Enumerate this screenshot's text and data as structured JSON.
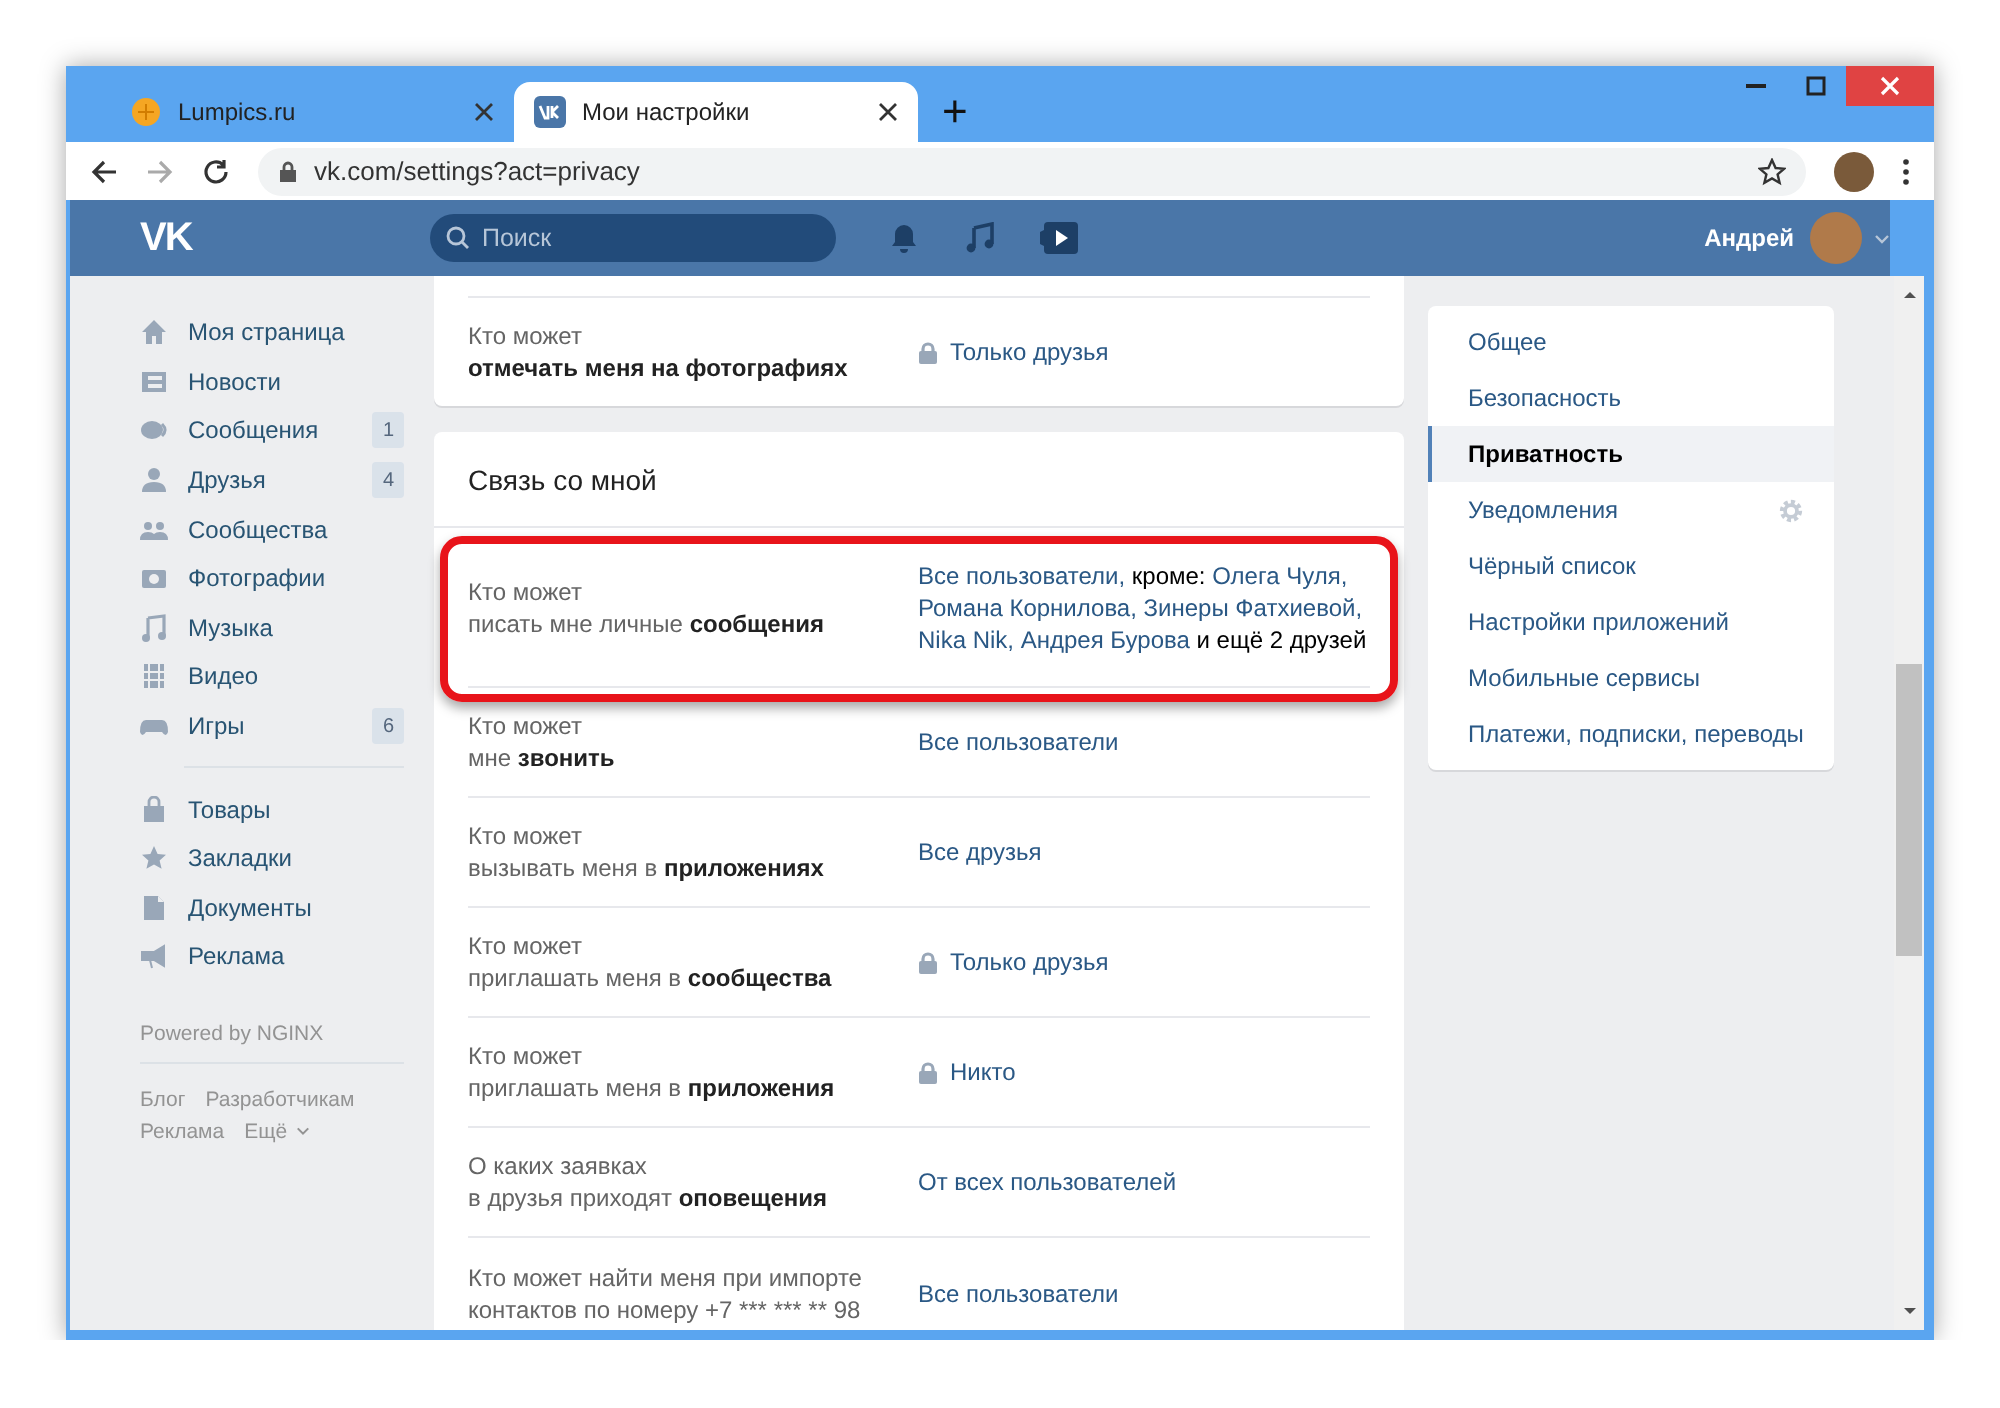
{
  "browser": {
    "tabs": [
      {
        "title": "Lumpics.ru",
        "selected": false
      },
      {
        "title": "Мои настройки",
        "selected": true
      }
    ],
    "new_tab": "+",
    "url": "vk.com/settings?act=privacy"
  },
  "header": {
    "logo": "VK",
    "search_placeholder": "Поиск",
    "user_name": "Андрей"
  },
  "sidebar": {
    "groups": [
      [
        {
          "label": "Моя страница"
        },
        {
          "label": "Новости"
        },
        {
          "label": "Сообщения",
          "counter": "1"
        },
        {
          "label": "Друзья",
          "counter": "4"
        },
        {
          "label": "Сообщества"
        },
        {
          "label": "Фотографии"
        },
        {
          "label": "Музыка"
        },
        {
          "label": "Видео"
        },
        {
          "label": "Игры",
          "counter": "6"
        }
      ],
      [
        {
          "label": "Товары"
        },
        {
          "label": "Закладки"
        },
        {
          "label": "Документы"
        },
        {
          "label": "Реклама"
        }
      ]
    ],
    "powered": "Powered by NGINX",
    "footer_links": [
      {
        "label": "Блог",
        "dropdown": false
      },
      {
        "label": "Разработчикам",
        "dropdown": false
      },
      {
        "label": "Реклама",
        "dropdown": false
      },
      {
        "label": "Ещё",
        "dropdown": true
      }
    ]
  },
  "sections": [
    {
      "rows": [
        {
          "line1": "Кто может",
          "line2": [
            {
              "text": "отмечать меня на фотографиях",
              "bold": true
            }
          ],
          "locked": true,
          "highlighted": false,
          "value": [
            {
              "kind": "link",
              "text": "Только друзья"
            }
          ]
        }
      ]
    },
    {
      "title": "Связь со мной",
      "rows": [
        {
          "line1": "Кто может",
          "line2": [
            {
              "text": "писать мне личные",
              "bold": false
            },
            {
              "text": "сообщения",
              "bold": true
            }
          ],
          "locked": false,
          "highlighted": true,
          "value": [
            {
              "kind": "link",
              "text": "Все пользователи,"
            },
            {
              "kind": "plain",
              "text": "кроме:"
            },
            {
              "kind": "link",
              "text": "Олега Чуля,"
            },
            {
              "kind": "link",
              "text": "Романа Корнилова,"
            },
            {
              "kind": "link",
              "text": "Зинеры Фатхиевой,"
            },
            {
              "kind": "link",
              "text": "Nika Nik,"
            },
            {
              "kind": "link",
              "text": "Андрея Бурова"
            },
            {
              "kind": "plain",
              "text": "и ещё 2 друзей"
            }
          ]
        },
        {
          "line1": "Кто может",
          "line2": [
            {
              "text": "мне",
              "bold": false
            },
            {
              "text": "звонить",
              "bold": true
            }
          ],
          "locked": false,
          "highlighted": false,
          "value": [
            {
              "kind": "link",
              "text": "Все пользователи"
            }
          ]
        },
        {
          "line1": "Кто может",
          "line2": [
            {
              "text": "вызывать меня в",
              "bold": false
            },
            {
              "text": "приложениях",
              "bold": true
            }
          ],
          "locked": false,
          "highlighted": false,
          "value": [
            {
              "kind": "link",
              "text": "Все друзья"
            }
          ]
        },
        {
          "line1": "Кто может",
          "line2": [
            {
              "text": "приглашать меня в",
              "bold": false
            },
            {
              "text": "сообщества",
              "bold": true
            }
          ],
          "locked": true,
          "highlighted": false,
          "value": [
            {
              "kind": "link",
              "text": "Только друзья"
            }
          ]
        },
        {
          "line1": "Кто может",
          "line2": [
            {
              "text": "приглашать меня в",
              "bold": false
            },
            {
              "text": "приложения",
              "bold": true
            }
          ],
          "locked": true,
          "highlighted": false,
          "value": [
            {
              "kind": "link",
              "text": "Никто"
            }
          ]
        },
        {
          "line1": "О каких заявках",
          "line2": [
            {
              "text": "в друзья приходят",
              "bold": false
            },
            {
              "text": "оповещения",
              "bold": true
            }
          ],
          "locked": false,
          "highlighted": false,
          "value": [
            {
              "kind": "link",
              "text": "От всех пользователей"
            }
          ]
        },
        {
          "line1": "Кто может найти меня при импорте",
          "line2": [
            {
              "text": "контактов по номеру +7 *** *** ** 98",
              "bold": false
            }
          ],
          "locked": false,
          "highlighted": false,
          "value": [
            {
              "kind": "link",
              "text": "Все пользователи"
            }
          ]
        }
      ]
    }
  ],
  "settings_menu": [
    {
      "label": "Общее",
      "selected": false,
      "gear": false
    },
    {
      "label": "Безопасность",
      "selected": false,
      "gear": false
    },
    {
      "label": "Приватность",
      "selected": true,
      "gear": false
    },
    {
      "label": "Уведомления",
      "selected": false,
      "gear": true
    },
    {
      "label": "Чёрный список",
      "selected": false,
      "gear": false
    },
    {
      "label": "Настройки приложений",
      "selected": false,
      "gear": false
    },
    {
      "label": "Мобильные сервисы",
      "selected": false,
      "gear": false
    },
    {
      "label": "Платежи, подписки, переводы",
      "selected": false,
      "gear": false
    }
  ]
}
